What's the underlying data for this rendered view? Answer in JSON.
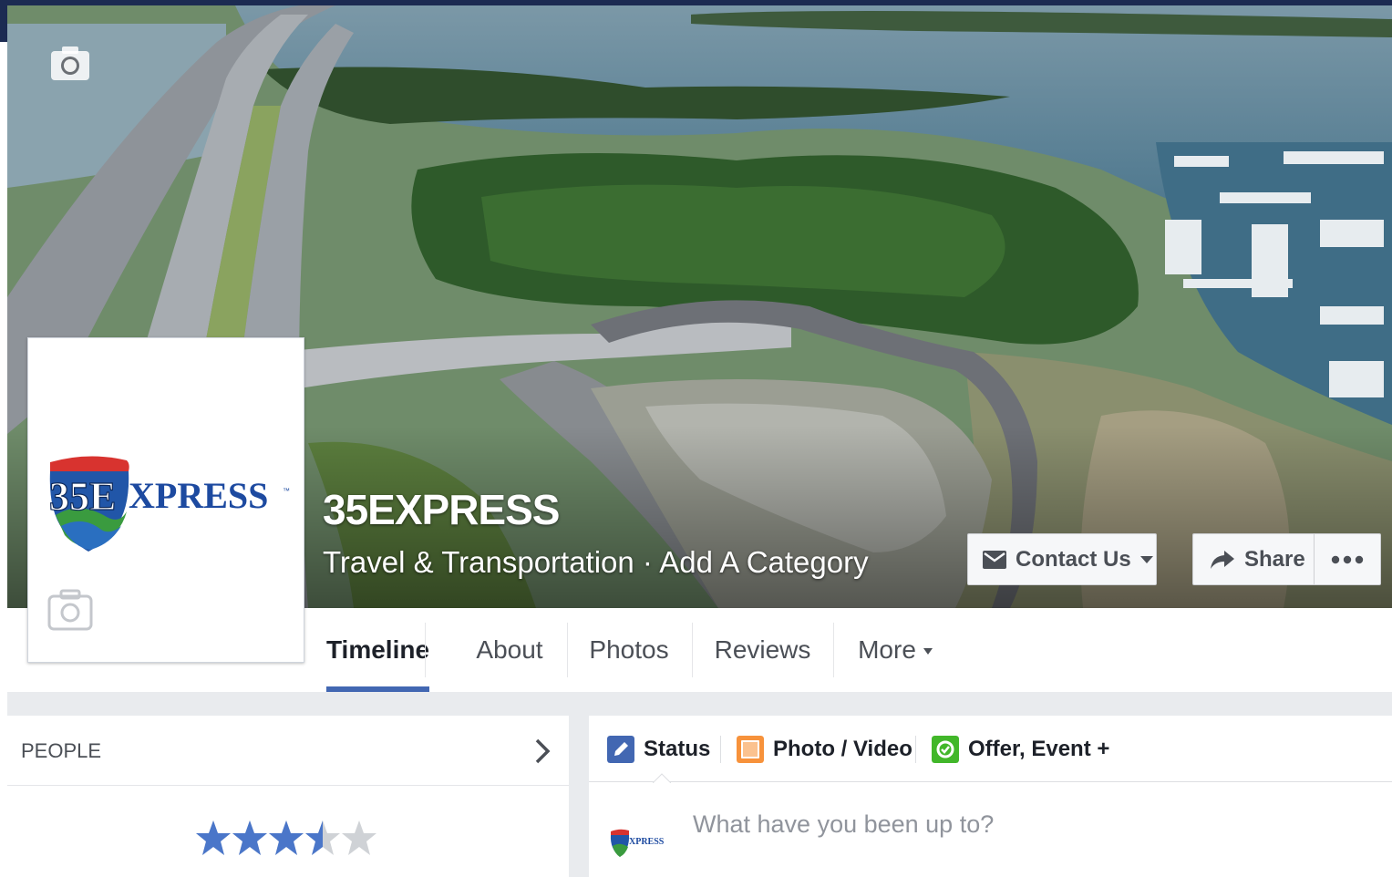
{
  "page": {
    "name": "35EXPRESS",
    "category": "Travel & Transportation · Add A Category",
    "logo_text": "35EXPRESS"
  },
  "actions": {
    "contact_label": "Contact Us",
    "share_label": "Share"
  },
  "tabs": [
    {
      "label": "Timeline",
      "active": true
    },
    {
      "label": "About",
      "active": false
    },
    {
      "label": "Photos",
      "active": false
    },
    {
      "label": "Reviews",
      "active": false
    },
    {
      "label": "More",
      "active": false
    }
  ],
  "people": {
    "title": "PEOPLE",
    "rating": 3.5,
    "rating_max": 5
  },
  "composer": {
    "tabs": [
      {
        "label": "Status",
        "icon": "pencil-icon",
        "color": "#4267b2"
      },
      {
        "label": "Photo / Video",
        "icon": "photo-icon",
        "color": "#f7923b"
      },
      {
        "label": "Offer, Event +",
        "icon": "offer-icon",
        "color": "#42b72a"
      }
    ],
    "placeholder": "What have you been up to?"
  },
  "colors": {
    "accent": "#4267b2",
    "star": "#4a76c9",
    "star_empty": "#cfd2d6",
    "topbar": "#1c2b52"
  }
}
